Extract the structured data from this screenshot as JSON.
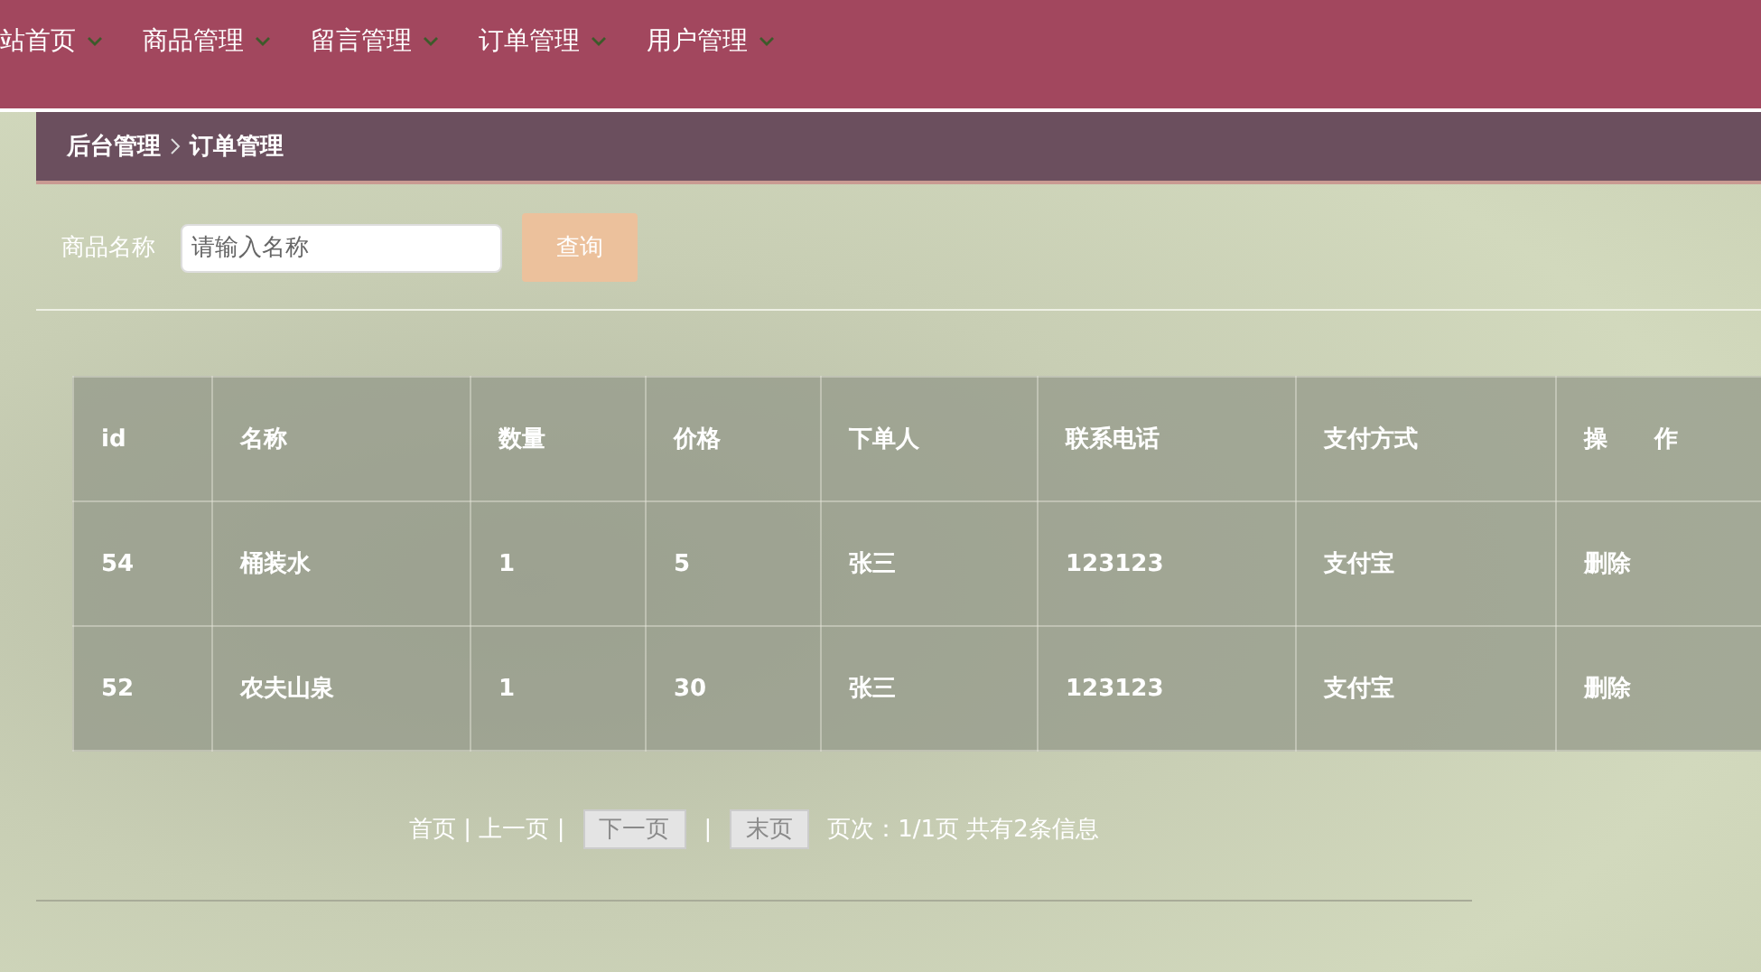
{
  "nav": {
    "items": [
      {
        "label": "站首页"
      },
      {
        "label": "商品管理"
      },
      {
        "label": "留言管理"
      },
      {
        "label": "订单管理"
      },
      {
        "label": "用户管理"
      }
    ]
  },
  "breadcrumb": [
    "后台管理",
    "订单管理"
  ],
  "search": {
    "label": "商品名称",
    "placeholder": "请输入名称",
    "button": "查询"
  },
  "table": {
    "columns": [
      "id",
      "名称",
      "数量",
      "价格",
      "下单人",
      "联系电话",
      "支付方式",
      "操　　作"
    ],
    "rows": [
      [
        "54",
        "桶装水",
        "1",
        "5",
        "张三",
        "123123",
        "支付宝",
        "删除"
      ],
      [
        "52",
        "农夫山泉",
        "1",
        "30",
        "张三",
        "123123",
        "支付宝",
        "删除"
      ]
    ]
  },
  "pagination": {
    "first": "首页 | 上一页 |",
    "next": "下一页",
    "separator": "|",
    "last": "末页",
    "info": "页次：1/1页 共有2条信息"
  }
}
